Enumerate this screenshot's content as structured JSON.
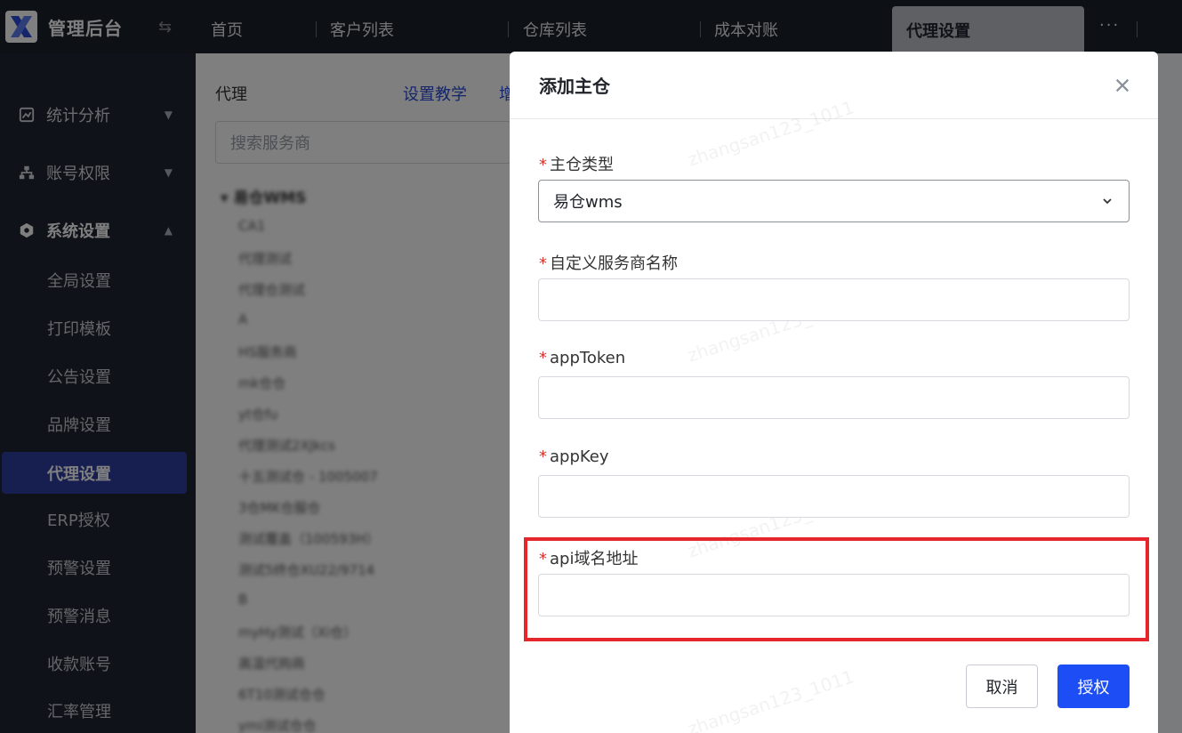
{
  "app": {
    "title": "管理后台"
  },
  "sidebar": {
    "items": [
      {
        "label": "统计分析",
        "icon": "chart-icon"
      },
      {
        "label": "账号权限",
        "icon": "org-icon"
      },
      {
        "label": "系统设置",
        "icon": "hexagon-gear-icon"
      }
    ],
    "sub_items": [
      "全局设置",
      "打印模板",
      "公告设置",
      "品牌设置",
      "代理设置",
      "ERP授权",
      "预警设置",
      "预警消息",
      "收款账号",
      "汇率管理"
    ],
    "active": "代理设置"
  },
  "tabs": {
    "items": [
      "首页",
      "客户列表",
      "仓库列表",
      "成本对账"
    ],
    "active": "代理设置",
    "more": "···"
  },
  "panel": {
    "title": "代理",
    "link": "设置教学",
    "link2": "增",
    "search_placeholder": "搜索服务商",
    "tree_root": "易仓WMS",
    "tree_items": [
      "CA1",
      "代理测试",
      "代理仓测试",
      "A",
      "HS服务商",
      "mk仓仓",
      "yt仓fu",
      "代理测试2XJkcs",
      "十五测试仓 - 1005007",
      "3仓MK仓服仓",
      "测试覆盖（100593H）",
      "测试5终仓XU22/9714",
      "B",
      "myHy测试（Xi仓）",
      "高温代购商",
      "6T10测试仓仓",
      "ymi测试仓仓"
    ]
  },
  "modal": {
    "title": "添加主仓",
    "fields": [
      {
        "label": "主仓类型",
        "value": "易仓wms",
        "type": "select"
      },
      {
        "label": "自定义服务商名称",
        "value": ""
      },
      {
        "label": "appToken",
        "value": ""
      },
      {
        "label": "appKey",
        "value": ""
      },
      {
        "label": "api域名地址",
        "value": ""
      }
    ],
    "required_mark": "*",
    "cancel_label": "取消",
    "submit_label": "授权",
    "highlight_color": "#e5262d"
  },
  "watermark": "zhangsan123_1011"
}
